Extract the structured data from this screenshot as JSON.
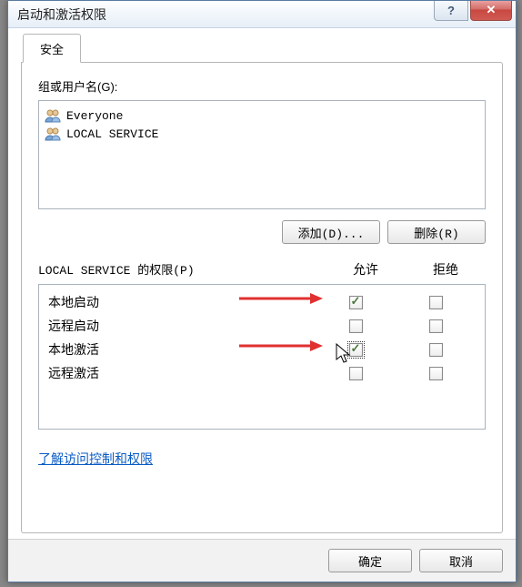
{
  "window": {
    "title": "启动和激活权限"
  },
  "tab": {
    "security": "安全"
  },
  "group_label": "组或用户名(G):",
  "users": [
    {
      "name": "Everyone",
      "title": "Everyone"
    },
    {
      "name": "LOCAL SERVICE",
      "title": "LOCAL SERVICE"
    }
  ],
  "buttons": {
    "add": "添加(D)...",
    "remove": "删除(R)",
    "ok": "确定",
    "cancel": "取消"
  },
  "perm_header": {
    "title": "LOCAL SERVICE 的权限(P)",
    "allow": "允许",
    "deny": "拒绝"
  },
  "permissions": [
    {
      "label": "本地启动",
      "allow": true,
      "deny": false
    },
    {
      "label": "远程启动",
      "allow": false,
      "deny": false
    },
    {
      "label": "本地激活",
      "allow": true,
      "deny": false
    },
    {
      "label": "远程激活",
      "allow": false,
      "deny": false
    }
  ],
  "link_text": "了解访问控制和权限"
}
